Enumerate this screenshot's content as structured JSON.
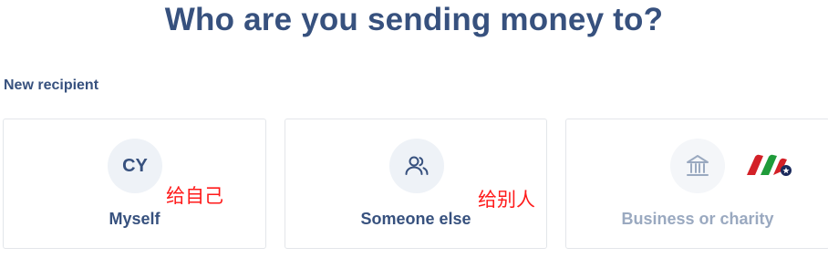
{
  "header": {
    "title": "Who are you sending money to?"
  },
  "section": {
    "label": "New recipient"
  },
  "cards": [
    {
      "avatar_initials": "CY",
      "label": "Myself"
    },
    {
      "icon": "people-icon",
      "label": "Someone else"
    },
    {
      "icon": "bank-icon",
      "label": "Business or charity",
      "disabled": true
    }
  ],
  "annotations": {
    "myself_note": "给自己",
    "someone_else_note": "给别人"
  },
  "colors": {
    "primary_text": "#37517e",
    "muted_text": "#9aa9c0",
    "avatar_bg": "#eef2f7",
    "annotation_red": "#ff1a1a",
    "logo_red": "#d32027",
    "logo_green": "#1f9b3a",
    "logo_navy": "#1b2a5c"
  }
}
